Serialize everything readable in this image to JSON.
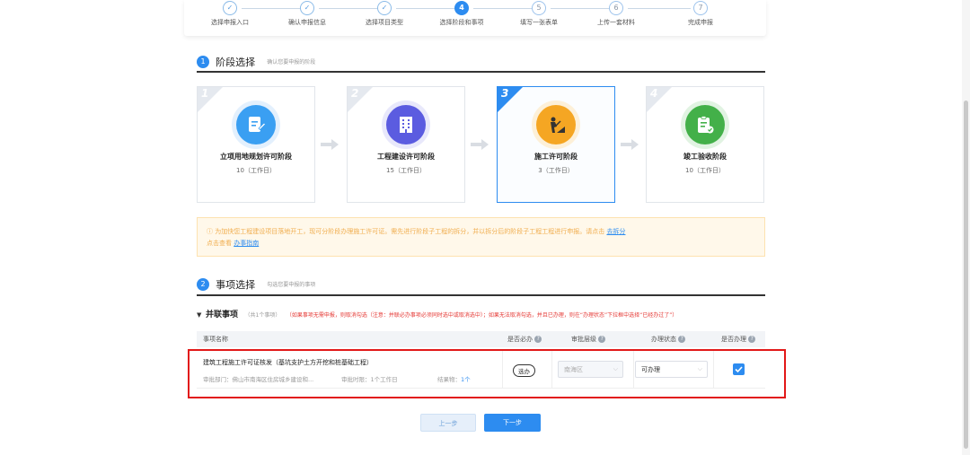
{
  "stepper": {
    "steps": [
      {
        "mark": "✓",
        "label": "选择申报入口",
        "state": "done"
      },
      {
        "mark": "✓",
        "label": "确认申报信息",
        "state": "done"
      },
      {
        "mark": "✓",
        "label": "选择项目类型",
        "state": "done"
      },
      {
        "mark": "4",
        "label": "选择阶段和事项",
        "state": "active"
      },
      {
        "mark": "5",
        "label": "填写一张表单",
        "state": "todo"
      },
      {
        "mark": "6",
        "label": "上传一套材料",
        "state": "todo"
      },
      {
        "mark": "7",
        "label": "完成申报",
        "state": "todo"
      }
    ]
  },
  "section_stage": {
    "num": "1",
    "title": "阶段选择",
    "hint": "确认您要申报的阶段"
  },
  "stages": [
    {
      "num": "1",
      "name": "立项用地规划许可阶段",
      "days": "10（工作日）",
      "color": "#3a9ff2",
      "icon": "document-edit-icon"
    },
    {
      "num": "2",
      "name": "工程建设许可阶段",
      "days": "15（工作日）",
      "color": "#5b5ce0",
      "icon": "building-icon"
    },
    {
      "num": "3",
      "name": "施工许可阶段",
      "days": "3（工作日）",
      "color": "#f5a623",
      "icon": "construction-worker-icon"
    },
    {
      "num": "4",
      "name": "竣工验收阶段",
      "days": "10（工作日）",
      "color": "#43b049",
      "icon": "checklist-icon"
    }
  ],
  "notice": {
    "line1": "ⓘ 为加快您工程建设项目落地开工，现可分阶段办理施工许可证。需先进行阶段子工程的拆分，并以拆分后的阶段子工程工程进行申报。请点击",
    "link1": "去拆分",
    "line2": "点击查看",
    "link2": "办事指南"
  },
  "section_items": {
    "num": "2",
    "title": "事项选择",
    "hint": "勾选您要申报的事项"
  },
  "group": {
    "toggle": "▼",
    "title": "并联事项",
    "count": "（共1个事项）",
    "note": "（如果事项无需申报，则取消勾选（注意：并联必办事项必须同时选中或取消选中）；如果无法取消勾选，并且已办理，则在“办理状态”下拉框中选择“已经办过了”）"
  },
  "table": {
    "headers": {
      "name": "事项名称",
      "required": "是否必办",
      "level": "审批层级",
      "status": "办理状态",
      "handle": "是否办理"
    },
    "help_glyph": "?",
    "row": {
      "name": "建筑工程施工许可证核发（基坑支护土方开挖和桩基础工程）",
      "dept": "审批部门：佛山市南海区住房城乡建设和...",
      "time": "审批时限：1个工作日",
      "result_label": "结果物：",
      "result_value": "1个",
      "required": "选办",
      "level": "南海区",
      "status": "可办理",
      "checked": true
    }
  },
  "buttons": {
    "prev": "上一步",
    "next": "下一步"
  },
  "colors": {
    "accent": "#2d8cf0",
    "highlight": "#e21818",
    "warning": "#f0ad4e"
  }
}
